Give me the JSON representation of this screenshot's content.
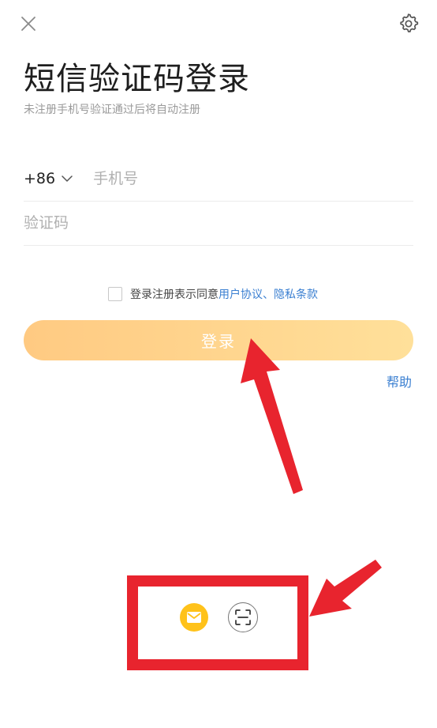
{
  "header": {
    "close_icon": "close-icon",
    "settings_icon": "gear-icon"
  },
  "login": {
    "title": "短信验证码登录",
    "subtitle": "未注册手机号验证通过后将自动注册",
    "country_code": "+86",
    "phone_placeholder": "手机号",
    "code_placeholder": "验证码",
    "agreement_prefix": "登录注册表示同意",
    "agreement_user_link": "用户协议",
    "agreement_separator": "、",
    "agreement_privacy_link": "隐私条款",
    "login_button": "登录",
    "help_link": "帮助"
  },
  "alt_login": {
    "email_icon": "mail-icon",
    "scan_icon": "scan-icon"
  },
  "colors": {
    "accent_gradient_start": "#ffca82",
    "accent_gradient_end": "#ffe09a",
    "link": "#3a7fd1",
    "mail_icon_bg": "#ffc21a",
    "annotation_red": "#e8242e"
  }
}
